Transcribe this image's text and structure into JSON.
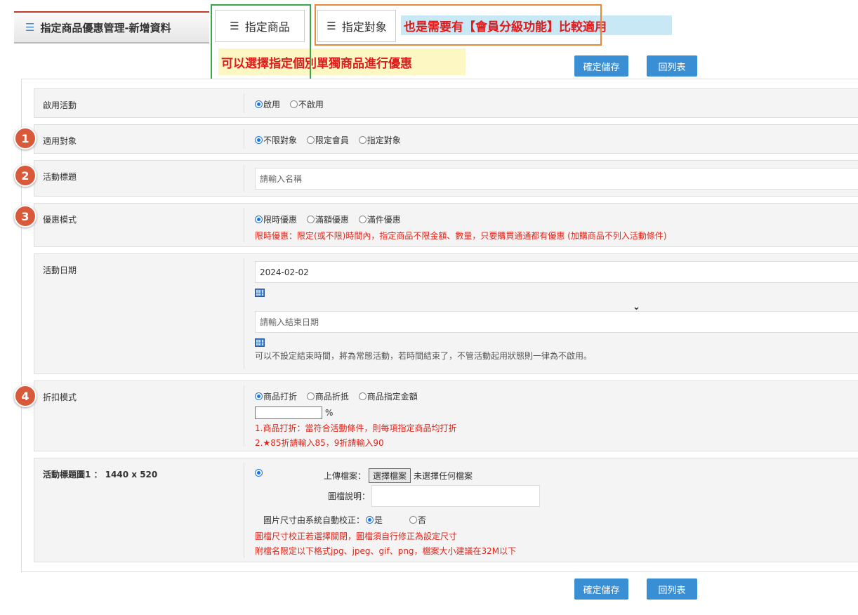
{
  "header": {
    "title": "指定商品優惠管理-新增資料",
    "tab_products": "指定商品",
    "tab_targets": "指定對象"
  },
  "annotations": {
    "members_note": "也是需要有【會員分級功能】比較適用",
    "products_note": "可以選擇指定個別單獨商品進行優惠"
  },
  "buttons": {
    "save": "確定儲存",
    "back": "回列表"
  },
  "badges": [
    "1",
    "2",
    "3",
    "4"
  ],
  "form": {
    "enable": {
      "label": "啟用活動",
      "options": [
        "啟用",
        "不啟用"
      ],
      "selected": 0
    },
    "target": {
      "label": "適用對象",
      "options": [
        "不限對象",
        "限定會員",
        "指定對象"
      ],
      "selected": 0
    },
    "title": {
      "label": "活動標題",
      "placeholder": "請輸入名稱"
    },
    "mode": {
      "label": "優惠模式",
      "options": [
        "限時優惠",
        "滿額優惠",
        "滿件優惠"
      ],
      "selected": 0,
      "hint": "限時優惠：限定(或不限)時間內，指定商品不限金額、數量，只要購買通通都有優惠 (加購商品不列入活動條件)"
    },
    "date": {
      "label": "活動日期",
      "start_value": "2024-02-02",
      "end_placeholder": "請輸入結束日期",
      "hint": "可以不設定結束時間，將為常態活動，若時間結束了，不管活動起用狀態則一律為不啟用。"
    },
    "discount": {
      "label": "折扣模式",
      "options": [
        "商品打折",
        "商品折抵",
        "商品指定金額"
      ],
      "selected": 0,
      "unit": "%",
      "hint1": "1.商品打折：當符合活動條件，則每項指定商品均打折",
      "hint2": "2.★85折請輸入85，9折請輸入90"
    },
    "image": {
      "label": "活動標題圖1 ： 1440 x 520",
      "upload_label": "上傳檔案：",
      "choose_button": "選擇檔案",
      "no_file": "未選擇任何檔案",
      "caption_label": "圖檔說明：",
      "autofix_label": "圖片尺寸由系統自動校正：",
      "yes": "是",
      "no": "否",
      "hint1": "圖檔尺寸校正若選擇關閉，圖檔須自行修正為設定尺寸",
      "hint2": "附檔名限定以下格式jpg、jpeg、gif、png，檔案大小建議在32M以下"
    }
  }
}
